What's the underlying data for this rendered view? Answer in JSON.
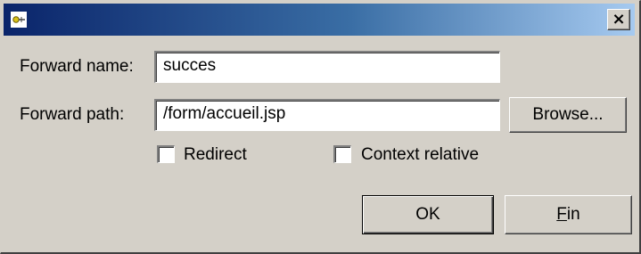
{
  "window": {
    "close_label": "×"
  },
  "form": {
    "forward_name": {
      "label": "Forward name:",
      "value": "succes"
    },
    "forward_path": {
      "label": "Forward path:",
      "value": "/form/accueil.jsp"
    },
    "browse_label": "Browse...",
    "redirect": {
      "label": "Redirect",
      "checked": false
    },
    "context_relative": {
      "label": "Context relative",
      "checked": false
    }
  },
  "buttons": {
    "ok_label": "OK",
    "fin_first": "F",
    "fin_rest": "in"
  },
  "colors": {
    "titlebar_start": "#0a246a",
    "titlebar_end": "#a6caf0",
    "dialog_bg": "#d4d0c8"
  },
  "icons": {
    "app": "plug-icon",
    "close": "close-icon"
  }
}
